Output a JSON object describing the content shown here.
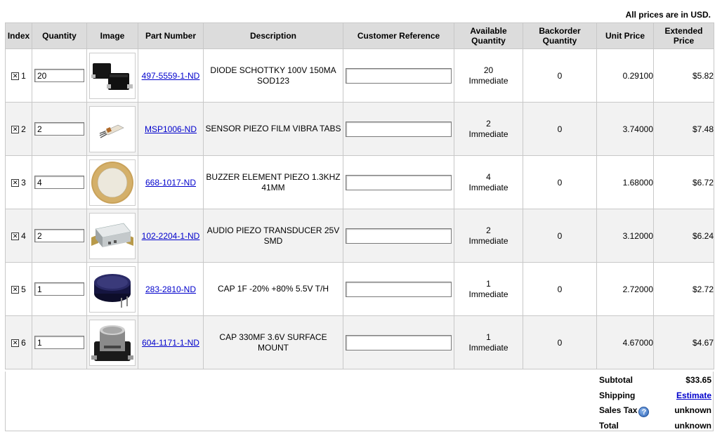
{
  "price_note": "All prices are in USD.",
  "columns": {
    "index": "Index",
    "quantity": "Quantity",
    "image": "Image",
    "part_number": "Part Number",
    "description": "Description",
    "customer_reference": "Customer Reference",
    "available_quantity": "Available Quantity",
    "backorder_quantity": "Backorder Quantity",
    "unit_price": "Unit Price",
    "extended_price": "Extended Price"
  },
  "checkbox_mark": "✕",
  "items": [
    {
      "index": "1",
      "quantity": "20",
      "image_icon": "schottky-diode-sod123-image",
      "part_number": "497-5559-1-ND",
      "description": "DIODE SCHOTTKY 100V 150MA SOD123",
      "customer_reference": "",
      "available_qty": "20",
      "available_status": "Immediate",
      "backorder_qty": "0",
      "unit_price": "0.29100",
      "extended_price": "$5.82"
    },
    {
      "index": "2",
      "quantity": "2",
      "image_icon": "piezo-film-sensor-image",
      "part_number": "MSP1006-ND",
      "description": "SENSOR PIEZO FILM VIBRA TABS",
      "customer_reference": "",
      "available_qty": "2",
      "available_status": "Immediate",
      "backorder_qty": "0",
      "unit_price": "3.74000",
      "extended_price": "$7.48"
    },
    {
      "index": "3",
      "quantity": "4",
      "image_icon": "piezo-buzzer-element-image",
      "part_number": "668-1017-ND",
      "description": "BUZZER ELEMENT PIEZO 1.3KHZ 41MM",
      "customer_reference": "",
      "available_qty": "4",
      "available_status": "Immediate",
      "backorder_qty": "0",
      "unit_price": "1.68000",
      "extended_price": "$6.72"
    },
    {
      "index": "4",
      "quantity": "2",
      "image_icon": "piezo-transducer-smd-image",
      "part_number": "102-2204-1-ND",
      "description": "AUDIO PIEZO TRANSDUCER 25V SMD",
      "customer_reference": "",
      "available_qty": "2",
      "available_status": "Immediate",
      "backorder_qty": "0",
      "unit_price": "3.12000",
      "extended_price": "$6.24"
    },
    {
      "index": "5",
      "quantity": "1",
      "image_icon": "supercapacitor-coin-image",
      "part_number": "283-2810-ND",
      "description": "CAP 1F -20% +80% 5.5V T/H",
      "customer_reference": "",
      "available_qty": "1",
      "available_status": "Immediate",
      "backorder_qty": "0",
      "unit_price": "2.72000",
      "extended_price": "$2.72"
    },
    {
      "index": "6",
      "quantity": "1",
      "image_icon": "surface-mount-capacitor-image",
      "part_number": "604-1171-1-ND",
      "description": "CAP 330MF 3.6V SURFACE MOUNT",
      "customer_reference": "",
      "available_qty": "1",
      "available_status": "Immediate",
      "backorder_qty": "0",
      "unit_price": "4.67000",
      "extended_price": "$4.67"
    }
  ],
  "totals": {
    "subtotal_label": "Subtotal",
    "subtotal_value": "$33.65",
    "shipping_label": "Shipping",
    "shipping_value": "Estimate",
    "sales_tax_label": "Sales Tax",
    "sales_tax_help": "?",
    "sales_tax_value": "unknown",
    "total_label": "Total",
    "total_value": "unknown"
  },
  "colors": {
    "header_bg": "#dcdcdc",
    "alt_row_bg": "#f2f2f2",
    "link": "#0000cc",
    "border": "#c8c8c8"
  }
}
